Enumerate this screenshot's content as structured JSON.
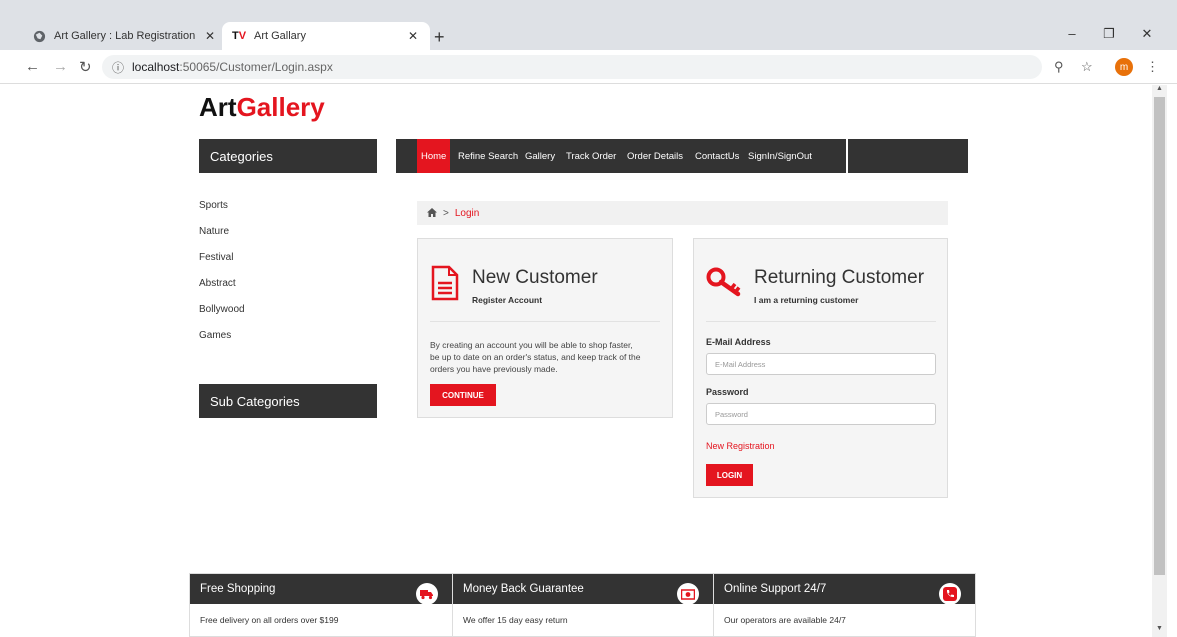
{
  "browser": {
    "tabs": [
      {
        "title": "Art Gallery : Lab Registration",
        "icon": "globe-icon"
      },
      {
        "title": "Art Gallary",
        "icon": "tv-favicon"
      }
    ],
    "new_tab": "+",
    "url_host": "localhost",
    "url_path": ":50065/Customer/Login.aspx",
    "profile_initial": "m"
  },
  "logo": {
    "part1": "Art",
    "part2": "Gallery",
    "accent_color": "#e4151f"
  },
  "sidebar": {
    "categories_title": "Categories",
    "categories": [
      "Sports",
      "Nature",
      "Festival",
      "Abstract",
      "Bollywood",
      "Games"
    ],
    "subcategories_title": "Sub Categories"
  },
  "nav": {
    "items": [
      "Home",
      "Refine Search",
      "Gallery",
      "Track Order",
      "Order Details",
      "ContactUs",
      "SignIn/SignOut"
    ]
  },
  "breadcrumb": {
    "current": "Login"
  },
  "new_customer": {
    "title": "New Customer",
    "subtitle": "Register Account",
    "text_lines": [
      "By creating an account you will be able to shop faster,",
      "be up to date on an order's status, and keep track of the",
      "orders you have previously made."
    ],
    "button": "CONTINUE"
  },
  "returning_customer": {
    "title": "Returning Customer",
    "subtitle": "I am a returning customer",
    "email_label": "E-Mail Address",
    "email_placeholder": "E-Mail Address",
    "password_label": "Password",
    "password_placeholder": "Password",
    "register_link": "New Registration",
    "button": "LOGIN"
  },
  "footer": [
    {
      "title": "Free Shopping",
      "text": "Free delivery on all orders over $199",
      "icon": "truck-icon"
    },
    {
      "title": "Money Back Guarantee",
      "text": "We offer 15 day easy return",
      "icon": "money-icon"
    },
    {
      "title": "Online Support 24/7",
      "text": "Our operators are available 24/7",
      "icon": "phone-icon"
    }
  ]
}
